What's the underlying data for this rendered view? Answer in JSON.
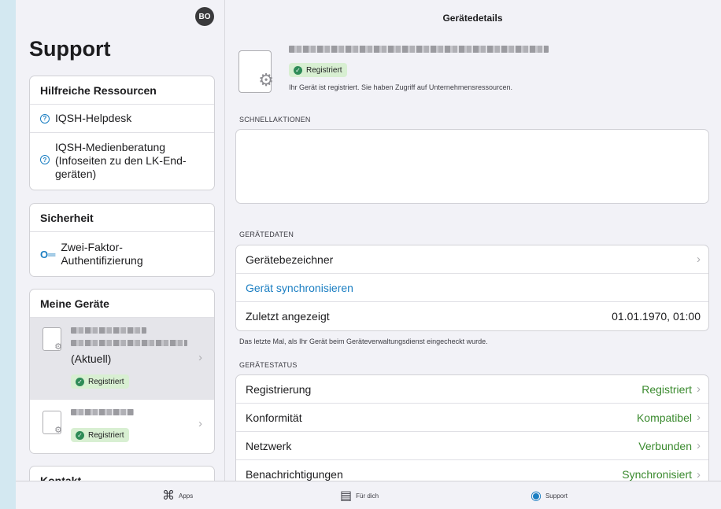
{
  "sidebar": {
    "avatar": "BO",
    "title": "Support",
    "resources": {
      "heading": "Hilfreiche Ressourcen",
      "items": [
        {
          "label": "IQSH-Helpdesk"
        },
        {
          "label": "IQSH-Medienberatung (Infoseiten zu den LK-End-geräten)"
        }
      ]
    },
    "security": {
      "heading": "Sicherheit",
      "items": [
        {
          "label": "Zwei-Faktor-Authentifizierung"
        }
      ]
    },
    "devices": {
      "heading": "Meine Geräte",
      "current_label": "(Aktuell)",
      "badge": "Registriert"
    },
    "contact": {
      "heading": "Kontakt"
    }
  },
  "main": {
    "nav_title": "Gerätedetails",
    "header": {
      "badge": "Registriert",
      "message": "Ihr Gerät ist registriert. Sie haben Zugriff auf Unternehmensressourcen."
    },
    "quick_actions_label": "SCHNELLAKTIONEN",
    "device_data_label": "GERÄTEDATEN",
    "device_data": {
      "identifier": "Gerätebezeichner",
      "sync": "Gerät synchronisieren",
      "last_seen_label": "Zuletzt angezeigt",
      "last_seen_value": "01.01.1970, 01:00"
    },
    "last_seen_note": "Das letzte Mal, als Ihr Gerät beim Geräteverwaltungsdienst eingecheckt wurde.",
    "status_label": "GERÄTESTATUS",
    "status_rows": [
      {
        "label": "Registrierung",
        "value": "Registriert"
      },
      {
        "label": "Konformität",
        "value": "Kompatibel"
      },
      {
        "label": "Netzwerk",
        "value": "Verbunden"
      },
      {
        "label": "Benachrichtigungen",
        "value": "Synchronisiert"
      }
    ]
  },
  "tabbar": {
    "apps": "Apps",
    "for_you": "Für dich",
    "support": "Support"
  },
  "colors": {
    "accent": "#1a7ec2",
    "status_green": "#3a8a2e",
    "badge_bg": "#d8efd2"
  }
}
